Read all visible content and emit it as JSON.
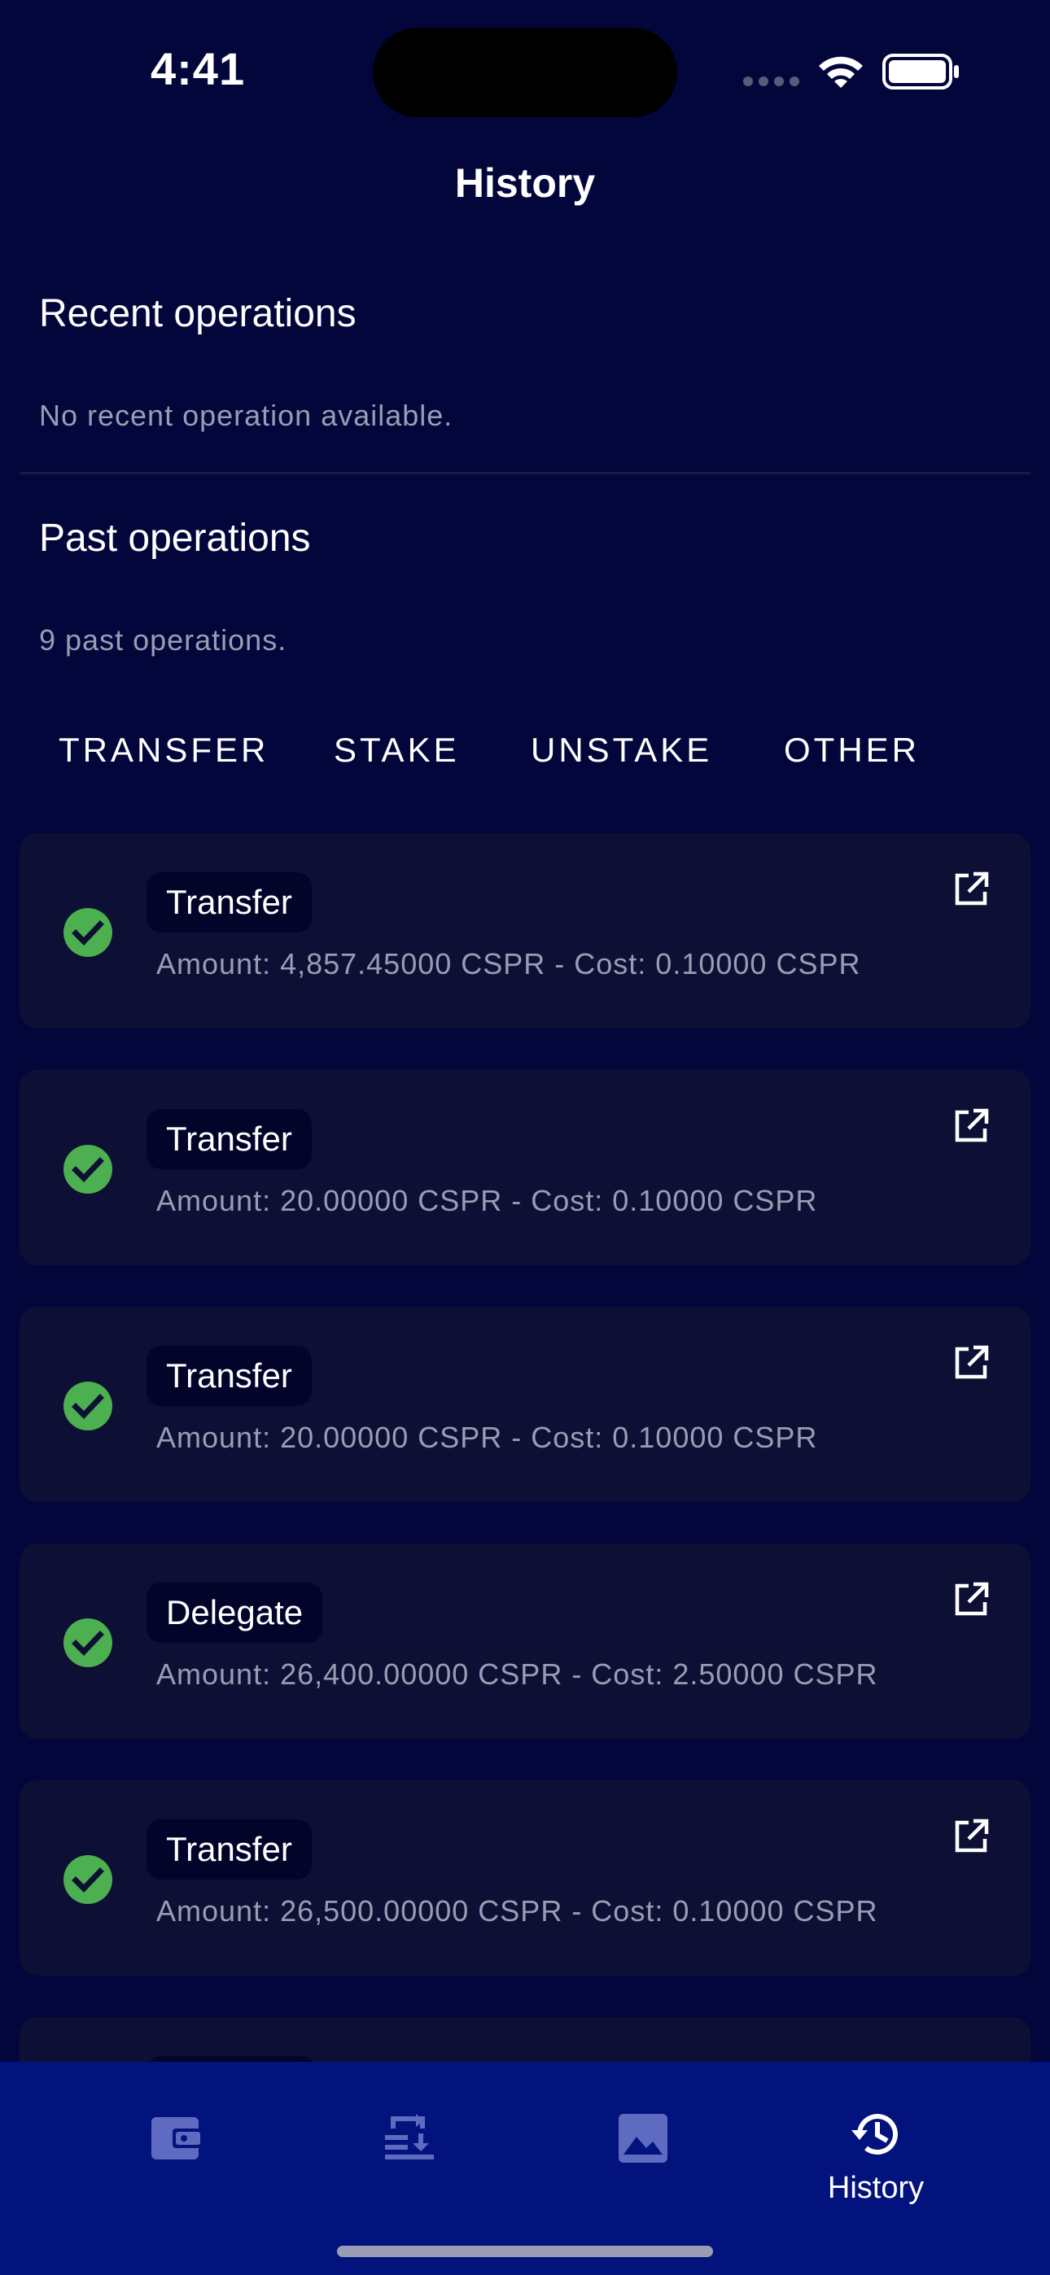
{
  "status_bar": {
    "time": "4:41"
  },
  "header": {
    "title": "History"
  },
  "recent": {
    "title": "Recent operations",
    "empty_message": "No recent operation available."
  },
  "past": {
    "title": "Past operations",
    "count_message": "9 past operations."
  },
  "filters": [
    {
      "label": "TRANSFER"
    },
    {
      "label": "STAKE"
    },
    {
      "label": "UNSTAKE"
    },
    {
      "label": "OTHER"
    }
  ],
  "operations": [
    {
      "status": "success",
      "type": "Transfer",
      "details": "Amount: 4,857.45000 CSPR - Cost: 0.10000 CSPR"
    },
    {
      "status": "success",
      "type": "Transfer",
      "details": "Amount: 20.00000 CSPR - Cost: 0.10000 CSPR"
    },
    {
      "status": "success",
      "type": "Transfer",
      "details": "Amount: 20.00000 CSPR - Cost: 0.10000 CSPR"
    },
    {
      "status": "success",
      "type": "Delegate",
      "details": "Amount: 26,400.00000 CSPR - Cost: 2.50000 CSPR"
    },
    {
      "status": "success",
      "type": "Transfer",
      "details": "Amount: 26,500.00000 CSPR - Cost: 0.10000 CSPR"
    }
  ],
  "bottom_nav": {
    "items": [
      {
        "icon": "wallet-icon",
        "label": ""
      },
      {
        "icon": "transactions-icon",
        "label": ""
      },
      {
        "icon": "image-icon",
        "label": ""
      },
      {
        "icon": "history-icon",
        "label": "History",
        "active": true
      }
    ]
  },
  "colors": {
    "background": "#03063a",
    "card": "#0d1034",
    "success": "#4caf50",
    "nav_background": "#03137d",
    "inactive_nav_icon": "#5f6bc1",
    "muted_text": "#9a9cb3"
  }
}
